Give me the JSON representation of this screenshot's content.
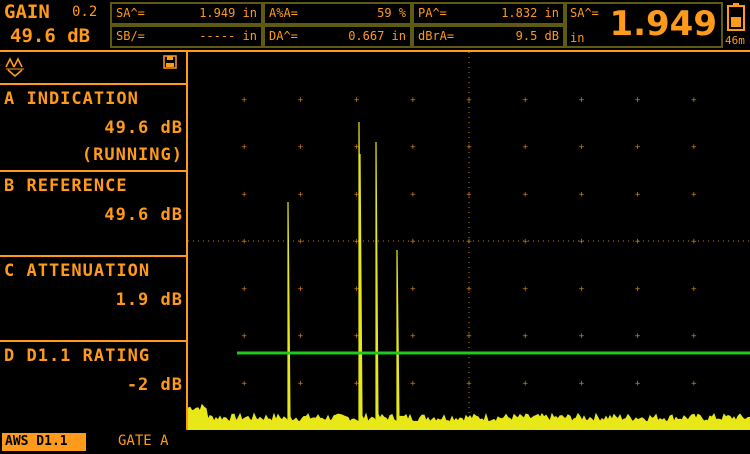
{
  "header": {
    "gain_label": "GAIN",
    "gain_step": "0.2",
    "gain_value": "49.6 dB",
    "readings": [
      {
        "label": "SA^=",
        "value": "1.949 in"
      },
      {
        "label": "A%A=",
        "value": "59 %"
      },
      {
        "label": "PA^=",
        "value": "1.832 in"
      },
      {
        "label": "SB/=",
        "value": "----- in"
      },
      {
        "label": "DA^=",
        "value": "0.667 in"
      },
      {
        "label": "dBrA=",
        "value": "9.5 dB"
      }
    ],
    "big_label": "SA^=",
    "big_unit": "in",
    "big_value": "1.949",
    "battery_text": "46m"
  },
  "sidebar": {
    "items": [
      {
        "title": "A INDICATION",
        "value": "49.6 dB",
        "sub": "(RUNNING)"
      },
      {
        "title": "B REFERENCE",
        "value": "49.6 dB"
      },
      {
        "title": "C ATTENUATION",
        "value": "1.9 dB"
      },
      {
        "title": "D D1.1 RATING",
        "value": "-2 dB"
      }
    ]
  },
  "footer": {
    "mode": "AWS D1.1",
    "gate": "GATE A"
  },
  "colors": {
    "accent": "#ff9a1a",
    "frame": "#5e5a14",
    "signal": "#e8e818",
    "gate": "#22c81e",
    "grid": "#c87a10"
  },
  "icons": [
    "rectify-icon",
    "save-disk-icon",
    "battery-icon"
  ]
}
